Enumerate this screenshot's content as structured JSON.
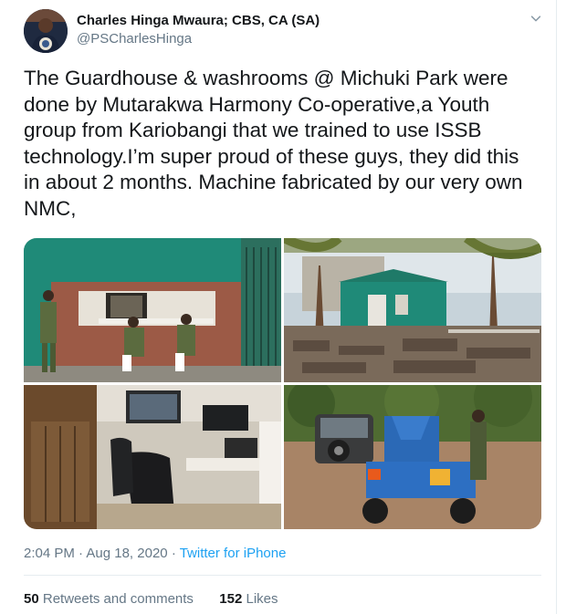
{
  "author": {
    "name": "Charles Hinga Mwaura; CBS, CA (SA)",
    "handle": "@PSCharlesHinga"
  },
  "icons": {
    "menu": "chevron-down-icon",
    "avatar": "profile-photo"
  },
  "tweet": {
    "text": "The Guardhouse & washrooms @ Michuki Park were\ndone by Mutarakwa Harmony Co-operative,a Youth\ngroup from Kariobangi that we trained to use ISSB\ntechnology.I’m super proud of these guys, they did this\nin about 2 months. Machine fabricated by our very own\nNMC,"
  },
  "meta": {
    "time": "2:04 PM",
    "separator": "·",
    "date": "Aug 18, 2020",
    "source": "Twitter for iPhone"
  },
  "stats": {
    "retweets_count": "50",
    "retweets_label": "Retweets and comments",
    "likes_count": "152",
    "likes_label": "Likes"
  },
  "colors": {
    "accent": "#1da1f2",
    "secondary_text": "#657786",
    "primary_text": "#14171a",
    "divider": "#e6ecf0"
  }
}
